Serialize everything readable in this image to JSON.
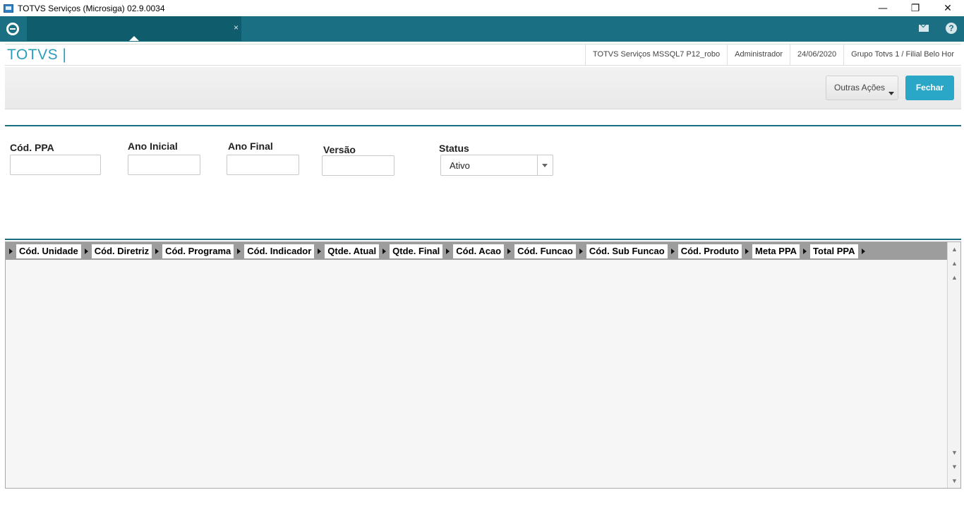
{
  "window": {
    "title": "TOTVS Serviços (Microsiga) 02.9.0034",
    "minimize": "—",
    "restore": "❐",
    "close": "✕"
  },
  "tabbar": {
    "tab_close": "×"
  },
  "header": {
    "brand": "TOTVS |",
    "environment": "TOTVS Serviços MSSQL7 P12_robo",
    "user": "Administrador",
    "date": "24/06/2020",
    "company": "Grupo Totvs 1 / Filial Belo Hor"
  },
  "toolbar": {
    "more_actions_label": "Outras Ações",
    "close_label": "Fechar"
  },
  "form": {
    "cod_ppa_label": "Cód. PPA",
    "ano_inicial_label": "Ano Inicial",
    "ano_final_label": "Ano Final",
    "versao_label": "Versão",
    "status_label": "Status",
    "status_value": "Ativo"
  },
  "grid": {
    "columns": [
      "Cód. Unidade",
      "Cód. Diretriz",
      "Cód. Programa",
      "Cód. Indicador",
      "Qtde. Atual",
      "Qtde. Final",
      "Cód. Acao",
      "Cód. Funcao",
      "Cód. Sub Funcao",
      "Cód. Produto",
      "Meta PPA",
      "Total PPA"
    ]
  },
  "colors": {
    "appbar": "#1b6f82",
    "accent": "#2aa6c6",
    "brand": "#2a9cbd"
  }
}
